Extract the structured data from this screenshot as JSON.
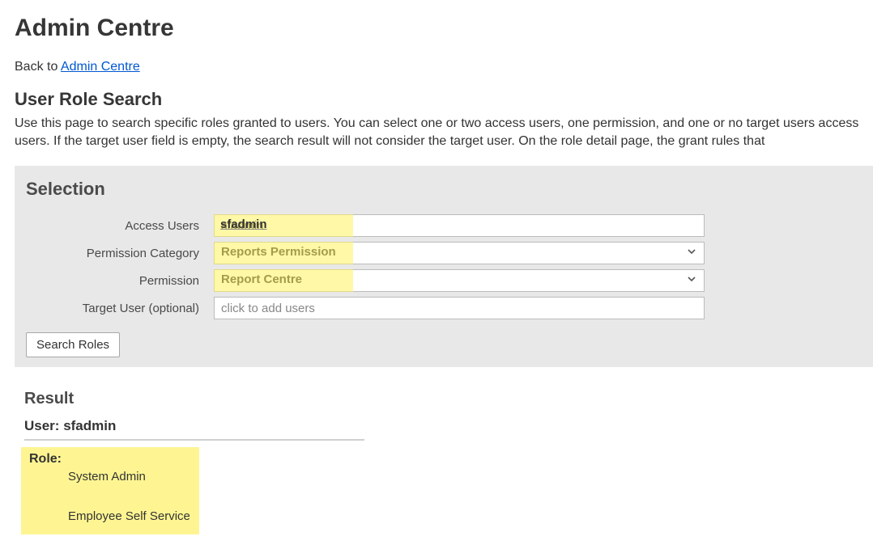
{
  "header": {
    "page_title": "Admin Centre",
    "back_prefix": "Back to ",
    "back_link": "Admin Centre"
  },
  "search": {
    "heading": "User Role Search",
    "description": "Use this page to search specific roles granted to users. You can select one or two access users, one permission, and one or no target users access users. If the target user field is empty, the search result will not consider the target user. On the role detail page, the grant rules that"
  },
  "selection": {
    "panel_title": "Selection",
    "labels": {
      "access_users": "Access Users",
      "permission_category": "Permission Category",
      "permission": "Permission",
      "target_user": "Target User (optional)"
    },
    "values": {
      "access_users": "sfadmin",
      "permission_category": "Reports Permission",
      "permission": "Report Centre",
      "target_user_placeholder": "click to add users"
    },
    "search_button": "Search Roles"
  },
  "result": {
    "heading": "Result",
    "user_prefix": "User: ",
    "user_value": "sfadmin",
    "role_label": "Role:",
    "roles": [
      "System Admin",
      "Employee Self Service"
    ]
  }
}
